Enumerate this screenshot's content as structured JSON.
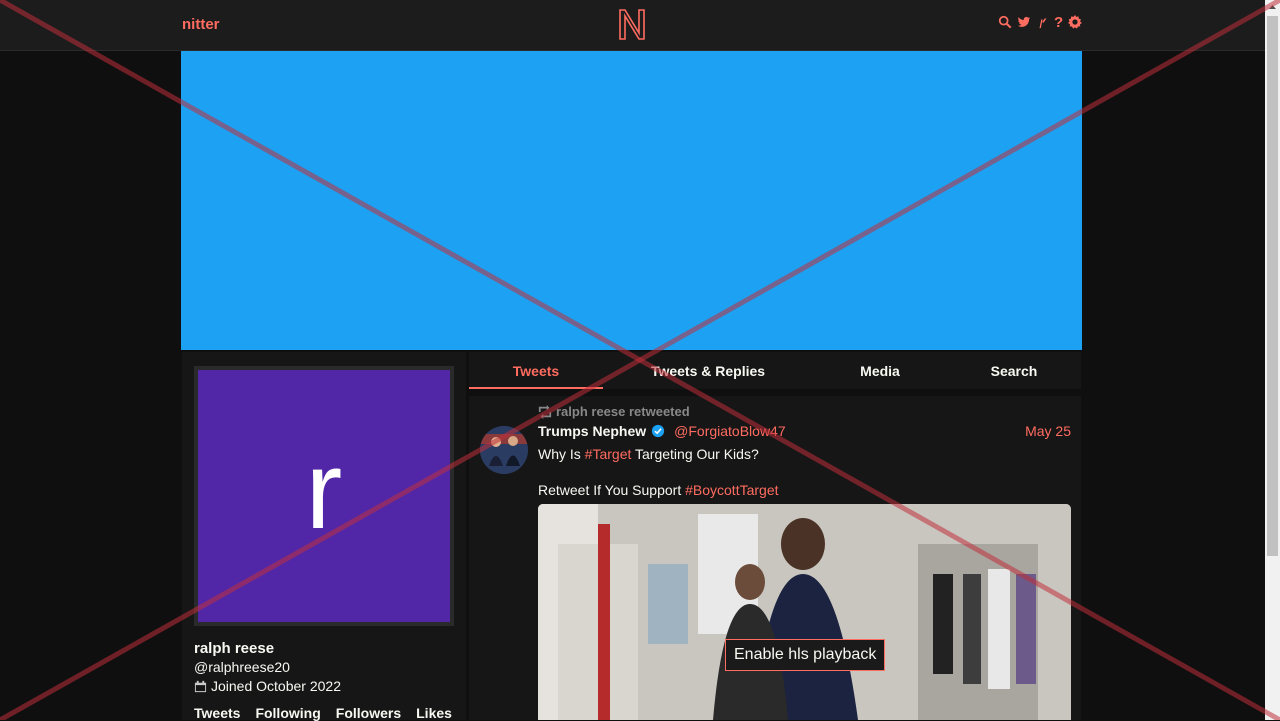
{
  "nav": {
    "logo_text": "nitter",
    "brand_letter": "N",
    "icons": [
      "search-icon",
      "twitter-icon",
      "rss-icon",
      "help-icon",
      "settings-icon"
    ],
    "help_glyph": "?"
  },
  "banner": {
    "color": "#1da1f2"
  },
  "profile": {
    "avatar_letter": "r",
    "avatar_color": "#5127a8",
    "fullname": "ralph reese",
    "username": "@ralphreese20",
    "joined": "Joined October 2022",
    "stats": [
      "Tweets",
      "Following",
      "Followers",
      "Likes"
    ]
  },
  "tabs": [
    {
      "label": "Tweets",
      "active": true
    },
    {
      "label": "Tweets & Replies",
      "active": false
    },
    {
      "label": "Media",
      "active": false
    },
    {
      "label": "Search",
      "active": false
    }
  ],
  "tweet": {
    "retweet_header": "ralph reese retweeted",
    "fullname": "Trumps Nephew",
    "username": "@ForgiatoBlow47",
    "date": "May 25",
    "line1_a": "Why Is ",
    "line1_hashtag": "#Target",
    "line1_b": " Targeting Our Kids?",
    "line2_a": "Retweet If You Support ",
    "line2_hashtag": "#BoycottTarget",
    "media_button": "Enable hls playback"
  },
  "colors": {
    "accent": "#ff6c60",
    "background": "#0f0f0f",
    "panel": "#161616",
    "nav": "#1c1c1c"
  }
}
